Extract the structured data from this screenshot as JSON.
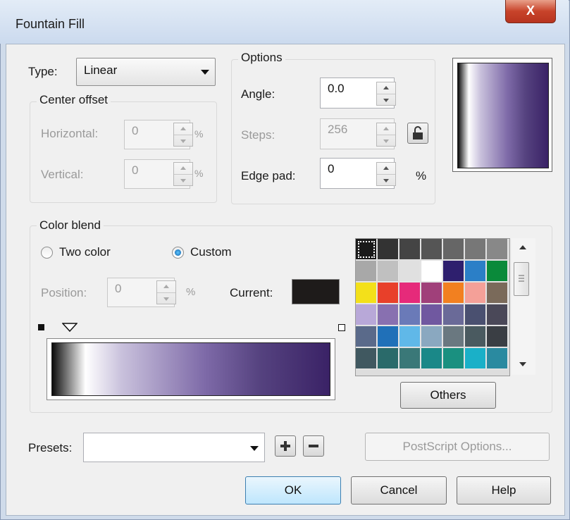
{
  "window": {
    "title": "Fountain Fill",
    "close_glyph": "X"
  },
  "type_field": {
    "label": "Type:",
    "value": "Linear"
  },
  "center_offset": {
    "title": "Center offset",
    "horizontal_label": "Horizontal:",
    "horizontal_value": "0",
    "horizontal_unit": "%",
    "vertical_label": "Vertical:",
    "vertical_value": "0",
    "vertical_unit": "%"
  },
  "options": {
    "title": "Options",
    "angle_label": "Angle:",
    "angle_value": "0.0",
    "steps_label": "Steps:",
    "steps_value": "256",
    "edge_pad_label": "Edge pad:",
    "edge_pad_value": "0",
    "edge_pad_unit": "%"
  },
  "color_blend": {
    "title": "Color blend",
    "two_color_label": "Two color",
    "custom_label": "Custom",
    "selected": "Custom",
    "position_label": "Position:",
    "position_value": "0",
    "position_unit": "%",
    "current_label": "Current:",
    "current_color": "#1e1b1a",
    "others_label": "Others"
  },
  "palette": {
    "colors": [
      "#1a1a1a",
      "#333333",
      "#444444",
      "#555555",
      "#666666",
      "#777777",
      "#888888",
      "#a8a8a8",
      "#c0c0c0",
      "#e0e0e0",
      "#ffffff",
      "#2e1f6e",
      "#2b7fc7",
      "#0a8a3a",
      "#f3e01a",
      "#e8402a",
      "#e62a7a",
      "#a0407a",
      "#f28020",
      "#f4a098",
      "#7a6a5a",
      "#b8a8d8",
      "#8870b0",
      "#6a7ab8",
      "#7058a0",
      "#6a6a98",
      "#4a5070",
      "#4a4858",
      "#5a6a8a",
      "#2070b8",
      "#60b8e8",
      "#8aa8c0",
      "#6a7880",
      "#4a5a60",
      "#3a3e44",
      "#405860",
      "#2a6a6a",
      "#3a7878",
      "#1a8888",
      "#1a9080",
      "#1ab0c8",
      "#2a8aa0"
    ]
  },
  "presets": {
    "label": "Presets:",
    "value": ""
  },
  "buttons": {
    "postscript": "PostScript Options...",
    "ok": "OK",
    "cancel": "Cancel",
    "help": "Help"
  }
}
